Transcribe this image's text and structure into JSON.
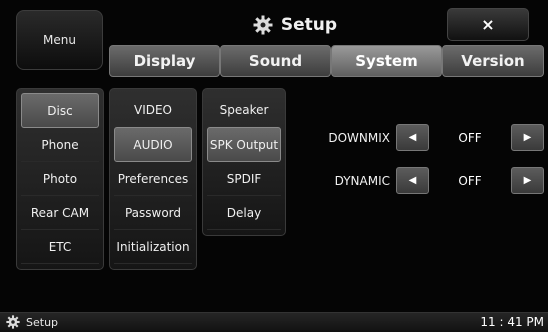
{
  "header": {
    "menu_label": "Menu",
    "title": "Setup",
    "title_icon": "gear-icon",
    "close_label": "×"
  },
  "tabs": [
    {
      "label": "Display",
      "active": false
    },
    {
      "label": "Sound",
      "active": false
    },
    {
      "label": "System",
      "active": true
    },
    {
      "label": "Version",
      "active": false
    }
  ],
  "sidebar": {
    "items": [
      {
        "label": "Disc",
        "selected": true
      },
      {
        "label": "Phone",
        "selected": false
      },
      {
        "label": "Photo",
        "selected": false
      },
      {
        "label": "Rear CAM",
        "selected": false
      },
      {
        "label": "ETC",
        "selected": false
      }
    ]
  },
  "submenu": {
    "items": [
      {
        "label": "VIDEO",
        "selected": false
      },
      {
        "label": "AUDIO",
        "selected": true
      },
      {
        "label": "Preferences",
        "selected": false
      },
      {
        "label": "Password",
        "selected": false
      },
      {
        "label": "Initialization",
        "selected": false
      }
    ]
  },
  "audio_menu": {
    "items": [
      {
        "label": "Speaker",
        "selected": false
      },
      {
        "label": "SPK Output",
        "selected": true
      },
      {
        "label": "SPDIF",
        "selected": false
      },
      {
        "label": "Delay",
        "selected": false
      }
    ]
  },
  "settings": [
    {
      "label": "DOWNMIX",
      "value": "OFF",
      "left_icon": "arrow-left-icon",
      "right_icon": "arrow-right-icon"
    },
    {
      "label": "DYNAMIC",
      "value": "OFF",
      "left_icon": "arrow-left-icon",
      "right_icon": "arrow-right-icon"
    }
  ],
  "footer": {
    "label": "Setup",
    "icon": "gear-icon",
    "time": "11 : 41 PM"
  }
}
